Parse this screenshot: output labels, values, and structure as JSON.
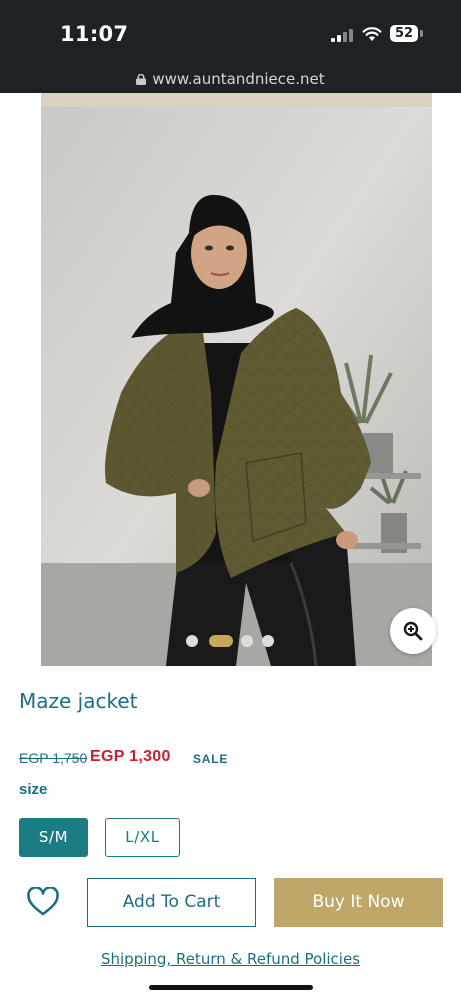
{
  "status_bar": {
    "time": "11:07",
    "battery": "52",
    "url": "www.auntandniece.net"
  },
  "product": {
    "title": "Maze jacket",
    "price_old": "EGP 1,750",
    "price_new": "EGP 1,300",
    "badge": "SALE",
    "image_count": 4,
    "active_image": 2
  },
  "size": {
    "label": "size",
    "options": [
      "S/M",
      "L/XL"
    ],
    "selected": "S/M"
  },
  "actions": {
    "add_to_cart": "Add To Cart",
    "buy_now": "Buy It Now"
  },
  "footer": {
    "policies_link": "Shipping, Return & Refund Policies"
  },
  "icons": [
    "lock-icon",
    "wifi-icon",
    "signal-icon",
    "zoom-in-icon",
    "heart-icon"
  ],
  "colors": {
    "accent": "#1b6f85",
    "sale": "#c8202a",
    "buy_now": "#bfa769",
    "selected_size": "#1b7c86"
  }
}
